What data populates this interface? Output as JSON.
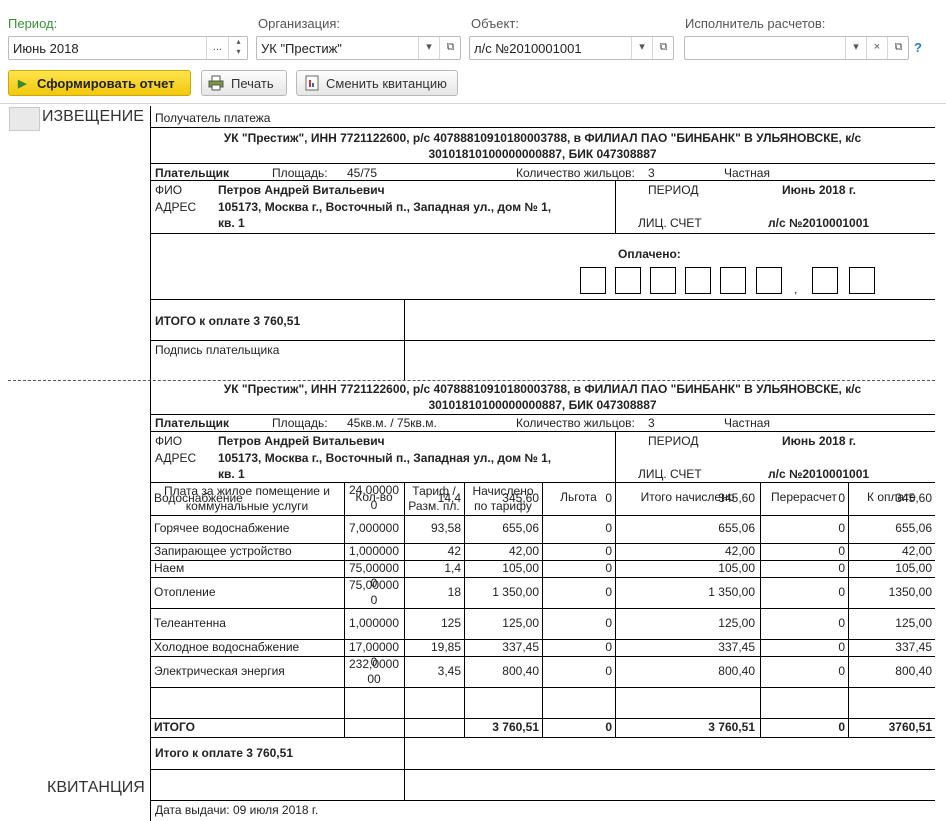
{
  "filters": {
    "period_label": "Период:",
    "period_value": "Июнь 2018",
    "org_label": "Организация:",
    "org_value": "УК \"Престиж\"",
    "object_label": "Объект:",
    "object_value": "л/с №2010001001",
    "executor_label": "Исполнитель расчетов:",
    "executor_value": ""
  },
  "toolbar": {
    "generate_label": "Сформировать отчет",
    "print_label": "Печать",
    "change_label": "Сменить квитанцию",
    "help_label": "?"
  },
  "notice": {
    "title": "ИЗВЕЩЕНИЕ",
    "recipient_label": "Получатель платежа",
    "recipient_line1": "УК \"Престиж\", ИНН 7721122600, р/с 40788810910180003788, в ФИЛИАЛ ПАО \"БИНБАНК\" В УЛЬЯНОВСКЕ, к/с",
    "recipient_line2": "30101810100000000887, БИК 047308887",
    "payer_label": "Плательщик",
    "area_label": "Площадь:",
    "area_value": "45/75",
    "residents_label": "Количество жильцов:",
    "residents_value": "3",
    "ownership": "Частная",
    "fio_label": "ФИО",
    "fio_value": "Петров Андрей Витальевич",
    "address_label": "АДРЕС",
    "address_line1": "105173, Москва г., Восточный п., Западная ул., дом № 1,",
    "address_line2": "кв. 1",
    "period_label": "ПЕРИОД",
    "period_value": "Июнь 2018 г.",
    "account_label": "ЛИЦ. СЧЕТ",
    "account_value": "л/с №2010001001",
    "paid_label": "Оплачено:",
    "comma": ",",
    "total_text": "ИТОГО к оплате 3 760,51",
    "signature_label": "Подпись плательщика"
  },
  "receipt": {
    "title": "КВИТАНЦИЯ",
    "recipient_line1": "УК \"Престиж\", ИНН 7721122600, р/с 40788810910180003788, в ФИЛИАЛ ПАО \"БИНБАНК\" В УЛЬЯНОВСКЕ, к/с",
    "recipient_line2": "30101810100000000887, БИК 047308887",
    "payer_label": "Плательщик",
    "area_label": "Площадь:",
    "area_value": "45кв.м. / 75кв.м.",
    "residents_label": "Количество жильцов:",
    "residents_value": "3",
    "ownership": "Частная",
    "fio_label": "ФИО",
    "fio_value": "Петров Андрей Витальевич",
    "address_label": "АДРЕС",
    "address_line1": "105173, Москва г., Восточный п., Западная ул., дом № 1,",
    "address_line2": "кв. 1",
    "period_label": "ПЕРИОД",
    "period_value": "Июнь 2018 г.",
    "account_label": "ЛИЦ. СЧЕТ",
    "account_value": "л/с №2010001001",
    "headers": {
      "service1": "Плата за жилое помещение и",
      "service2": "коммунальные услуги",
      "qty": "Кол-во",
      "tariff1": "Тариф /",
      "tariff2": "Разм. пл.",
      "charged1": "Начислено",
      "charged2": "по тарифу",
      "benefit": "Льгота",
      "total": "Итого начислено",
      "recalc": "Перерасчет",
      "topay": "К оплате"
    },
    "rows": [
      {
        "name": "Водоснабжение",
        "qty1": "24,00000",
        "qty2": "0",
        "tariff": "14,4",
        "charged": "345,60",
        "benefit": "0",
        "total": "345,60",
        "recalc": "0",
        "topay": "345,60"
      },
      {
        "name": "Горячее водоснабжение",
        "qty1": "7,000000",
        "qty2": "",
        "tariff": "93,58",
        "charged": "655,06",
        "benefit": "0",
        "total": "655,06",
        "recalc": "0",
        "topay": "655,06"
      },
      {
        "name": "Запирающее устройство",
        "qty1": "1,000000",
        "qty2": "",
        "tariff": "42",
        "charged": "42,00",
        "benefit": "0",
        "total": "42,00",
        "recalc": "0",
        "topay": "42,00"
      },
      {
        "name": "Наем",
        "qty1": "75,00000",
        "qty2": "0",
        "tariff": "1,4",
        "charged": "105,00",
        "benefit": "0",
        "total": "105,00",
        "recalc": "0",
        "topay": "105,00"
      },
      {
        "name": "Отопление",
        "qty1": "75,00000",
        "qty2": "0",
        "tariff": "18",
        "charged": "1 350,00",
        "benefit": "0",
        "total": "1 350,00",
        "recalc": "0",
        "topay": "1350,00"
      },
      {
        "name": "Телеантенна",
        "qty1": "1,000000",
        "qty2": "",
        "tariff": "125",
        "charged": "125,00",
        "benefit": "0",
        "total": "125,00",
        "recalc": "0",
        "topay": "125,00"
      },
      {
        "name": "Холодное водоснабжение",
        "qty1": "17,00000",
        "qty2": "0",
        "tariff": "19,85",
        "charged": "337,45",
        "benefit": "0",
        "total": "337,45",
        "recalc": "0",
        "topay": "337,45"
      },
      {
        "name": "Электрическая энергия",
        "qty1": "232,0000",
        "qty2": "00",
        "tariff": "3,45",
        "charged": "800,40",
        "benefit": "0",
        "total": "800,40",
        "recalc": "0",
        "topay": "800,40"
      }
    ],
    "totals": {
      "name": "ИТОГО",
      "charged": "3 760,51",
      "benefit": "0",
      "total": "3 760,51",
      "recalc": "0",
      "topay": "3760,51"
    },
    "total_text": "Итого к оплате 3 760,51",
    "issue_date": "Дата выдачи: 09 июля 2018 г."
  }
}
